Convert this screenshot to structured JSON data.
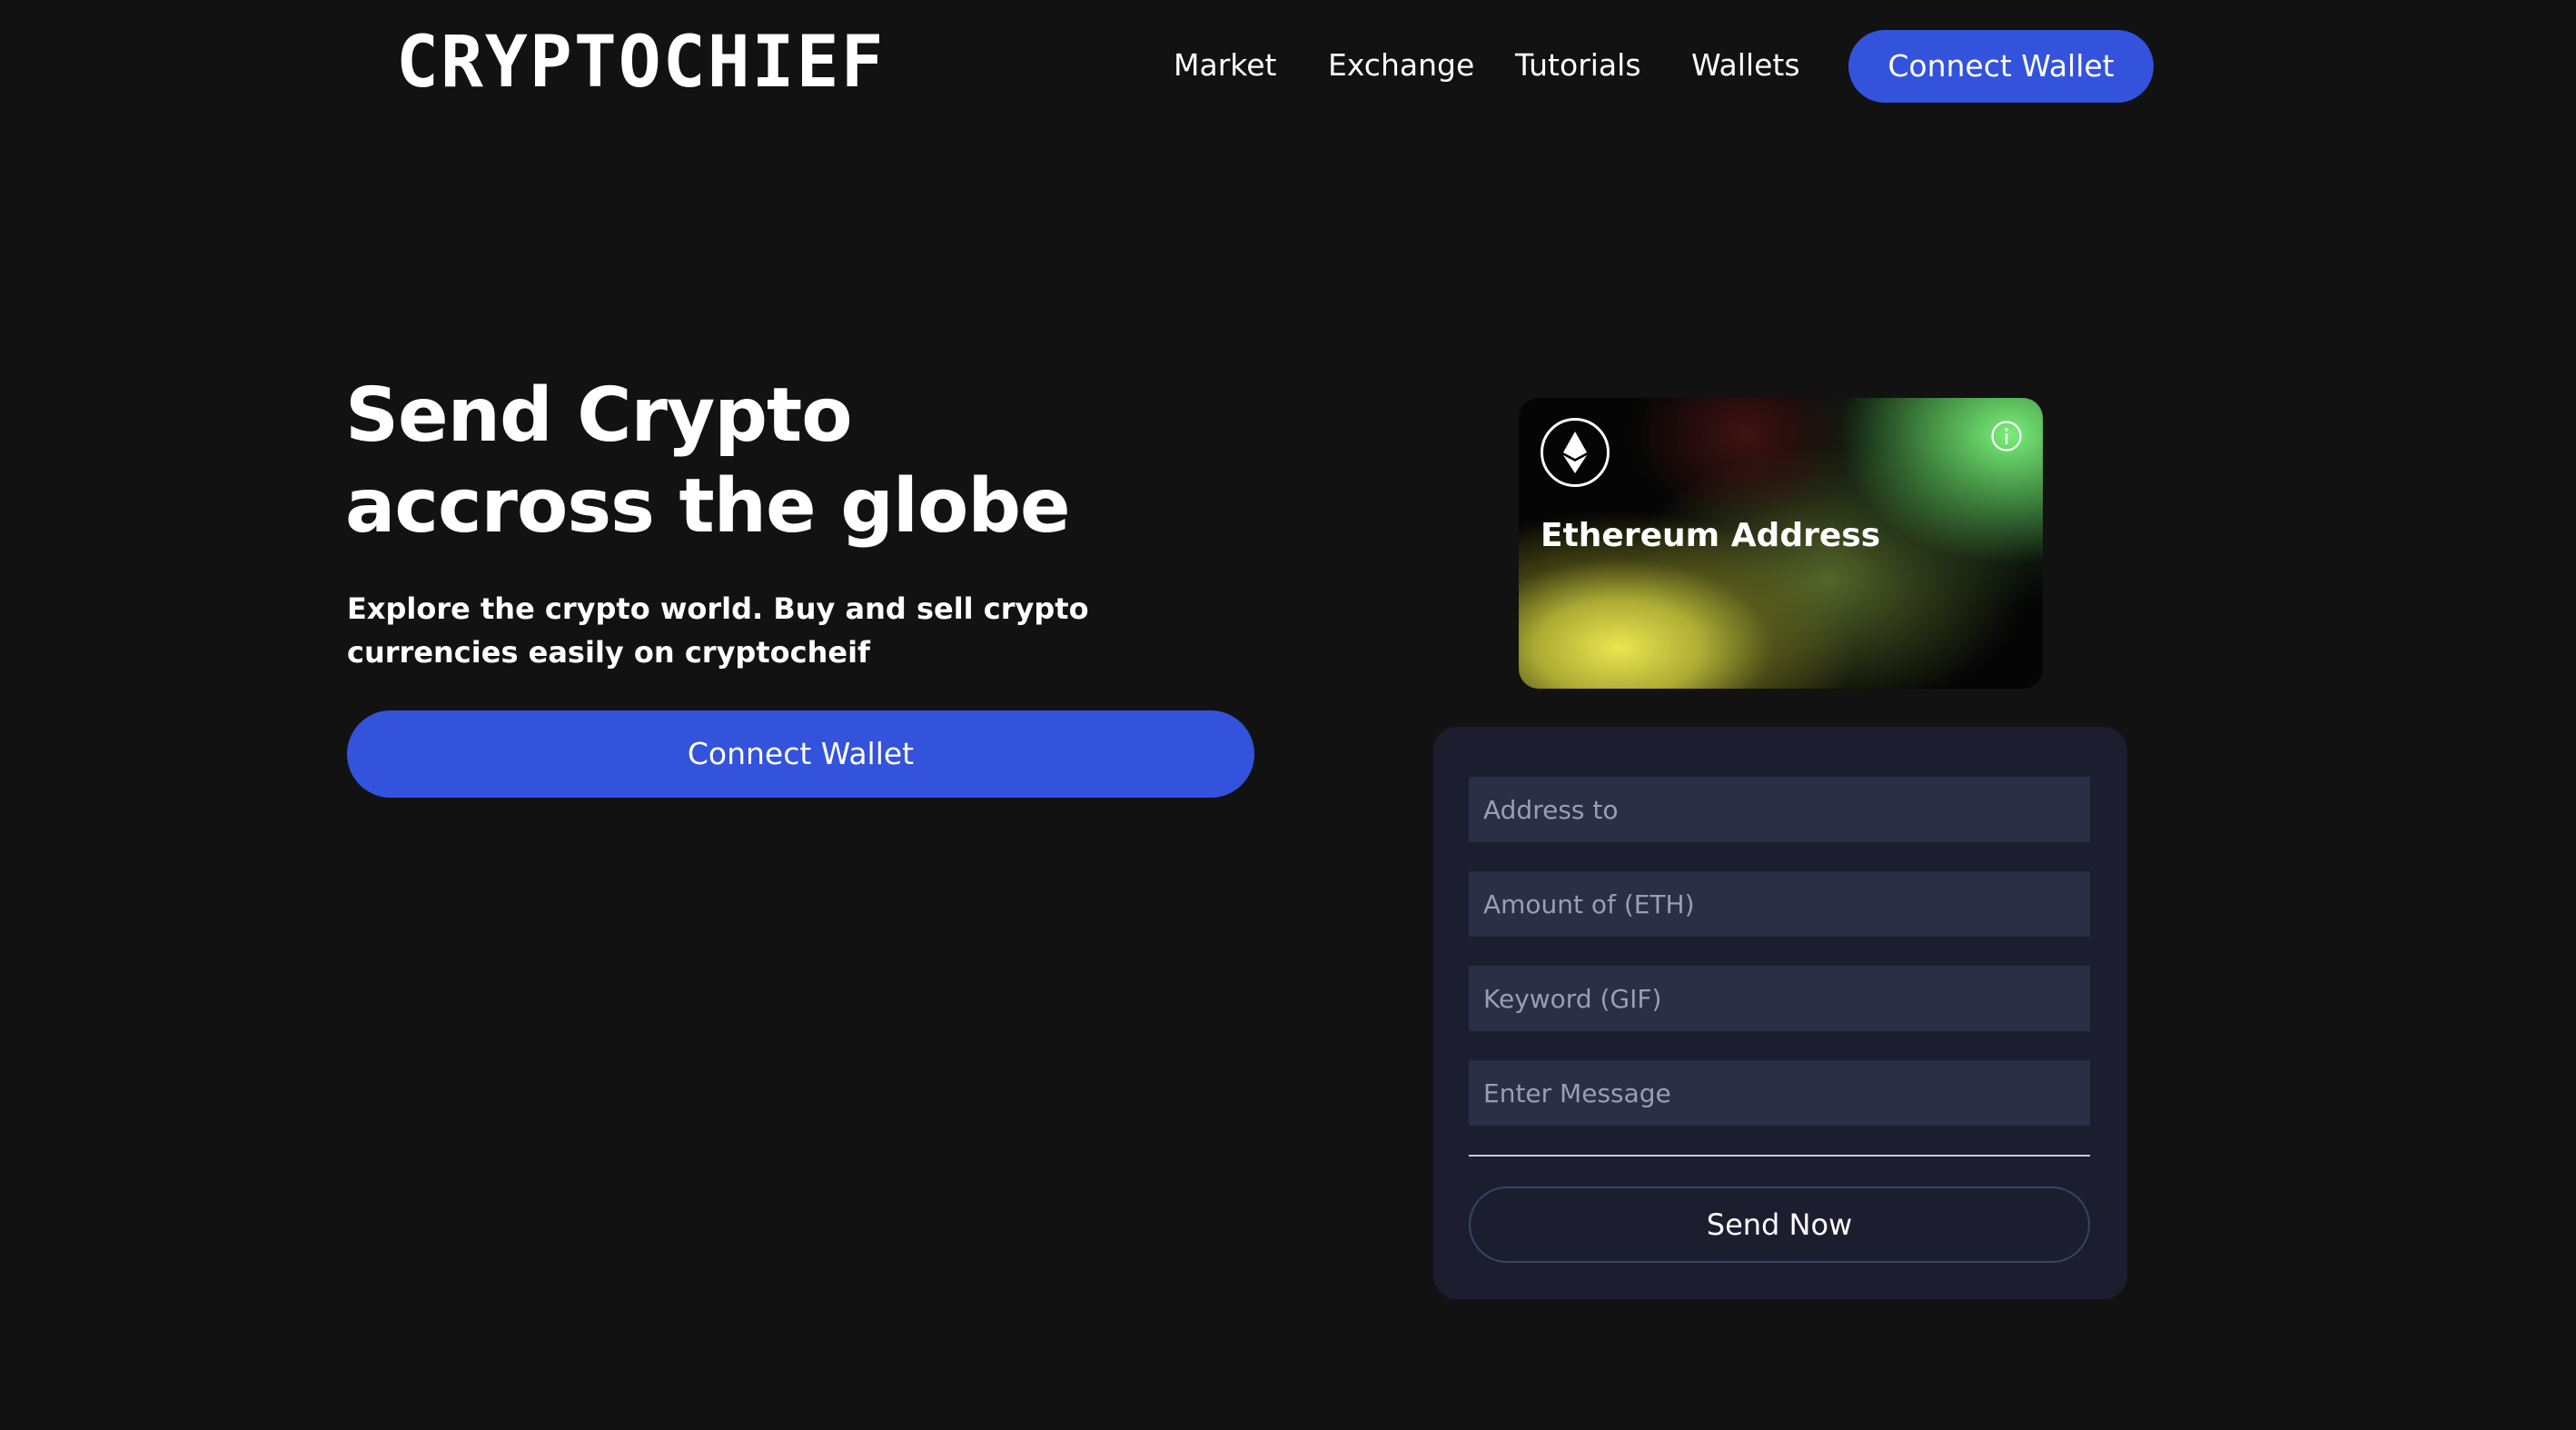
{
  "header": {
    "logo": "CRYPTOCHIEF",
    "nav": [
      "Market",
      "Exchange",
      "Tutorials",
      "Wallets"
    ],
    "connect_label": "Connect Wallet"
  },
  "hero": {
    "title_line1": "Send Crypto",
    "title_line2": "accross the globe",
    "subtitle": "Explore the crypto world. Buy and sell crypto currencies easily on cryptocheif",
    "connect_label": "Connect Wallet"
  },
  "card": {
    "label": "Ethereum Address",
    "icon": "ethereum-icon",
    "info_icon": "info-icon"
  },
  "form": {
    "address_placeholder": "Address to",
    "amount_placeholder": "Amount of (ETH)",
    "keyword_placeholder": "Keyword (GIF)",
    "message_placeholder": "Enter Message",
    "send_label": "Send Now"
  },
  "colors": {
    "background": "#121212",
    "accent": "#3353dc",
    "panel": "#1c1e2f",
    "input": "#2c2e45"
  }
}
